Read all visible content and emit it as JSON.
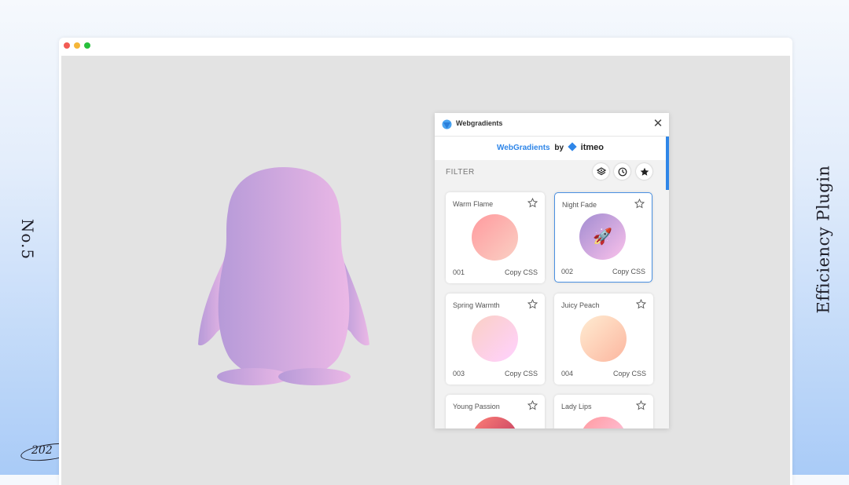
{
  "side_left_text": "No.5",
  "side_right_text": "Efficiency Plugin",
  "year_badge": "202",
  "popup": {
    "title": "Webgradients",
    "brand": {
      "name": "WebGradients",
      "by": "by",
      "company": "itmeo"
    },
    "filter_label": "FILTER",
    "filter_icons": [
      "layers-icon",
      "clock-icon",
      "star-filled-icon"
    ],
    "copy_label": "Copy CSS",
    "gradients": [
      {
        "name": "Warm Flame",
        "number": "001",
        "colors": [
          "#ff9a9e",
          "#fad0c4"
        ]
      },
      {
        "name": "Night Fade",
        "number": "002",
        "colors": [
          "#a18cd1",
          "#fbc2eb"
        ],
        "selected": true,
        "icon": "🚀"
      },
      {
        "name": "Spring Warmth",
        "number": "003",
        "colors": [
          "#fad0c4",
          "#ffd1ff"
        ]
      },
      {
        "name": "Juicy Peach",
        "number": "004",
        "colors": [
          "#ffecd2",
          "#fcb69f"
        ]
      },
      {
        "name": "Young Passion",
        "number": "",
        "colors": [
          "#ff8177",
          "#b12a5b"
        ]
      },
      {
        "name": "Lady Lips",
        "number": "",
        "colors": [
          "#ff9a9e",
          "#fecfef"
        ]
      }
    ]
  },
  "colors": {
    "accent": "#2f86e8",
    "penguin_left": "#b69ad8",
    "penguin_right": "#ebb8e6"
  }
}
